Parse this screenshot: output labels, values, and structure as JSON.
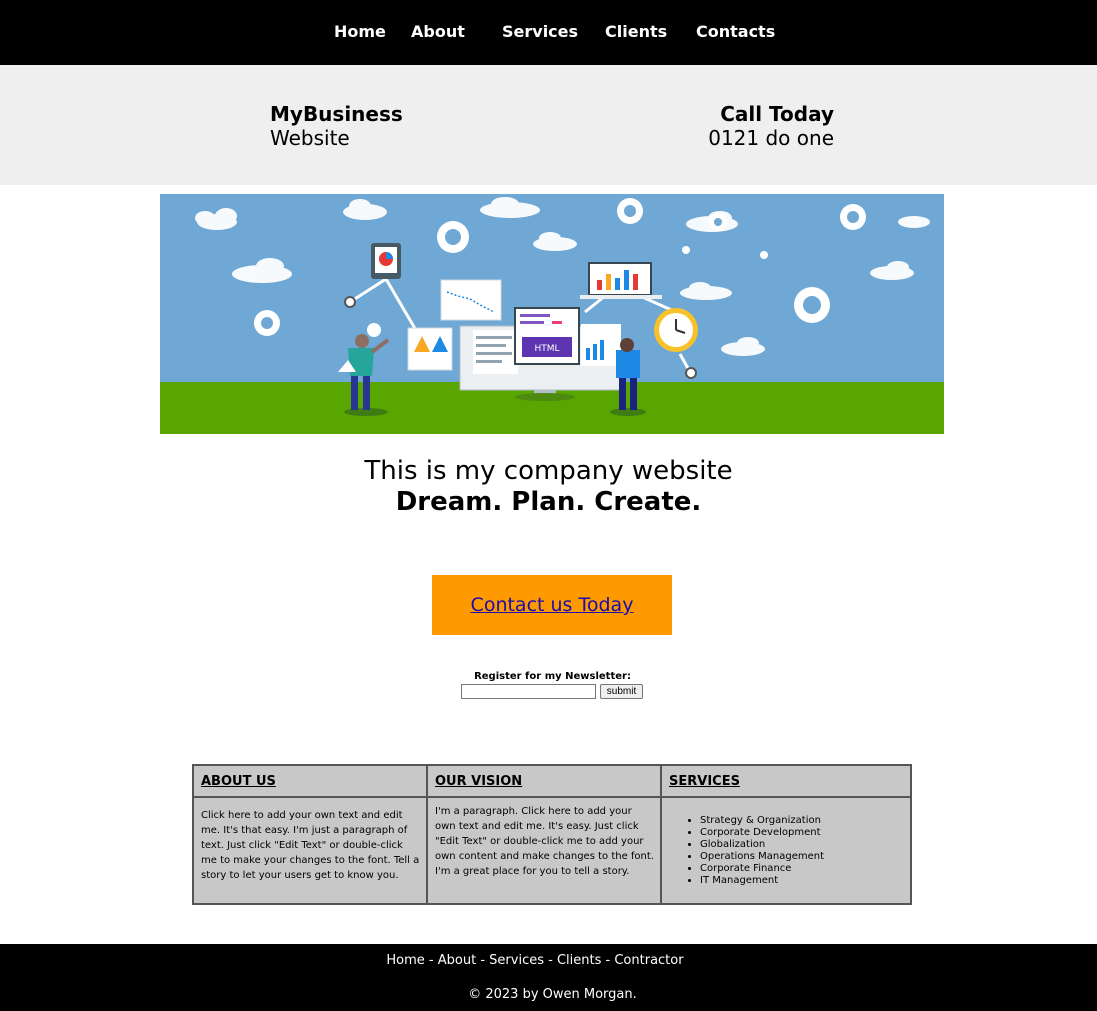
{
  "nav": {
    "items": [
      "Home",
      "About",
      "Services",
      "Clients",
      "Contacts"
    ]
  },
  "header": {
    "brand_title": "MyBusiness",
    "brand_sub": "Website",
    "call_title": "Call Today",
    "call_number": "0121 do one"
  },
  "hero": {
    "illustration_badge": "HTML"
  },
  "intro": {
    "tagline": "This is my company website",
    "motto": "Dream. Plan. Create."
  },
  "cta": {
    "label": "Contact us Today"
  },
  "newsletter": {
    "label": "Register for my Newsletter:",
    "input_value": "",
    "submit_label": "submit"
  },
  "info": {
    "about": {
      "heading": "ABOUT US",
      "text": "Click here to add your own text and edit me. It's that easy. I'm just a paragraph of text. Just click \"Edit Text\" or double-click me to make your changes to the font. Tell a story to let your users get to know you."
    },
    "vision": {
      "heading": "OUR VISION",
      "text": "I'm a paragraph. Click here to add your own text and edit me. It's easy. Just click \"Edit Text\" or double-click me to add your own content and make changes to the font. I'm a great place for you to tell a story."
    },
    "services": {
      "heading": "SERVICES",
      "items": [
        "Strategy & Organization",
        "Corporate Development",
        "Globalization",
        "Operations Management",
        "Corporate Finance",
        "IT Management"
      ]
    }
  },
  "footer": {
    "links": [
      "Home",
      "About",
      "Services",
      "Clients",
      "Contractor"
    ],
    "separator": " - ",
    "copyright": "© 2023 by Owen Morgan."
  },
  "colors": {
    "nav_bg": "#000000",
    "band_bg": "#efefef",
    "cta_bg": "#fe9a00",
    "table_bg": "#c8c8c8",
    "sky": "#6fa8d5",
    "grass": "#5aa600"
  }
}
